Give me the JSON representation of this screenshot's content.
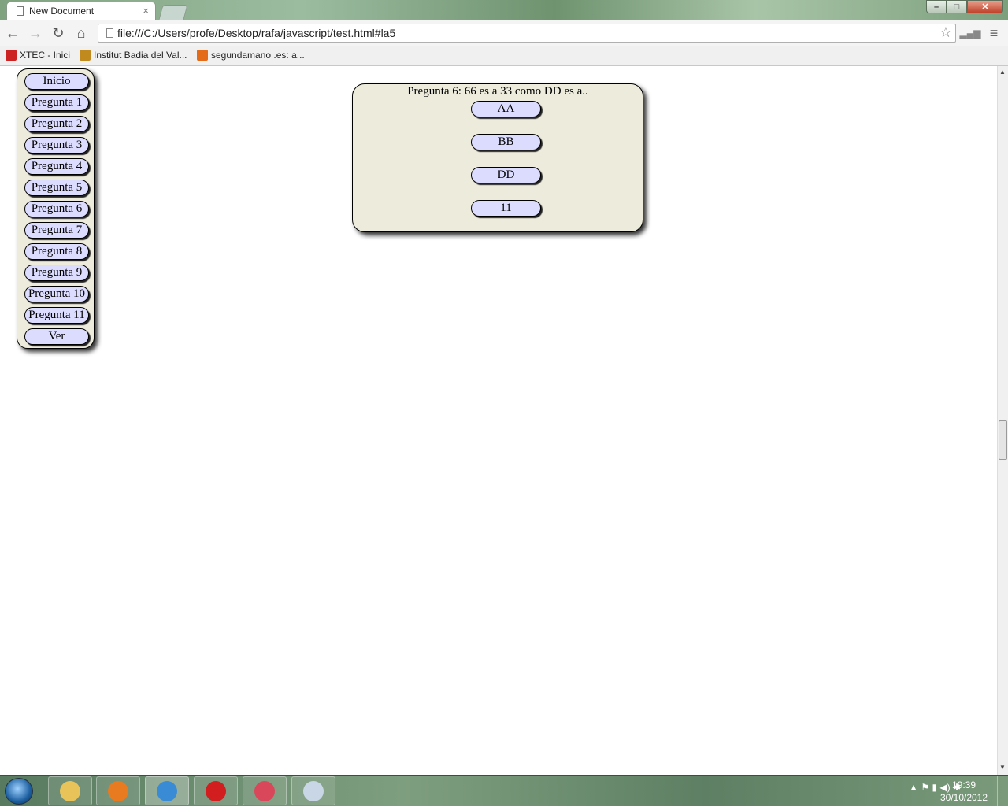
{
  "browser": {
    "tab_title": "New Document",
    "tab_close": "×",
    "url": "file:///C:/Users/profe/Desktop/rafa/javascript/test.html#la5",
    "window_buttons": {
      "minimize": "–",
      "maximize": "□",
      "close": "✕"
    },
    "nav": {
      "back": "←",
      "forward": "→",
      "reload": "↻",
      "home": "⌂",
      "star": "☆",
      "menu": "≡"
    },
    "bookmarks": [
      {
        "label": "XTEC - Inici",
        "color": "#cc2222"
      },
      {
        "label": "Institut Badia del Val...",
        "color": "#c08a1f"
      },
      {
        "label": "segundamano .es: a...",
        "color": "#e46b1a"
      }
    ]
  },
  "sidebar": {
    "items": [
      "Inicio",
      "Pregunta 1",
      "Pregunta 2",
      "Pregunta 3",
      "Pregunta 4",
      "Pregunta 5",
      "Pregunta 6",
      "Pregunta 7",
      "Pregunta 8",
      "Pregunta 9",
      "Pregunta 10",
      "Pregunta 11",
      "Ver"
    ]
  },
  "question": {
    "text": "Pregunta 6: 66 es a 33 como DD es a..",
    "answers": [
      "AA",
      "BB",
      "DD",
      "11"
    ]
  },
  "taskbar": {
    "apps": [
      {
        "name": "explorer",
        "color": "#e8c35a"
      },
      {
        "name": "firefox",
        "color": "#e87a20"
      },
      {
        "name": "chrome",
        "color": "#3a8bd6"
      },
      {
        "name": "opera",
        "color": "#d21e1e"
      },
      {
        "name": "app-red",
        "color": "#d9485a"
      },
      {
        "name": "paint",
        "color": "#c9d6e6"
      }
    ],
    "tray": "▲ ⚑ ▮ ◀) ✱",
    "time": "19:39",
    "date": "30/10/2012"
  },
  "colors": {
    "panel_bg": "#ecebdc",
    "button_bg": "#dcdcff"
  }
}
